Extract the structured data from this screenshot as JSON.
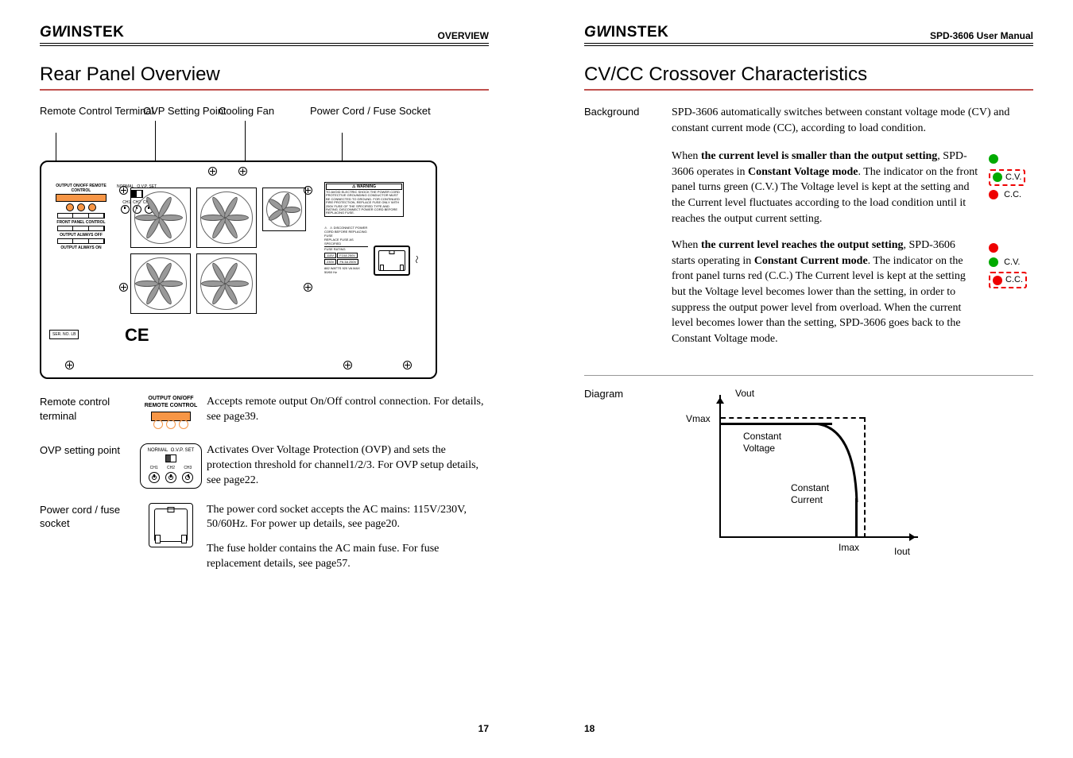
{
  "left": {
    "brand": "GWINSTEK",
    "header_right": "OVERVIEW",
    "title": "Rear Panel Overview",
    "callouts": {
      "remote": "Remote Control Terminal",
      "ovp": "OVP Setting Point",
      "fan": "Cooling Fan",
      "power": "Power Cord / Fuse Socket"
    },
    "panel": {
      "switch_title": "OUTPUT ON/OFF REMOTE CONTROL",
      "switch_lbl1": "FRONT PANEL CONTROL",
      "switch_lbl2": "OUTPUT ALWAYS OFF",
      "switch_lbl3": "OUTPUT ALWAYS ON",
      "ovp_normal": "NORMAL",
      "ovp_set": "O.V.P. SET",
      "ch1": "CH1",
      "ch2": "CH2",
      "ch3": "CH3",
      "serial": "SER. NO.  LB",
      "ce": "CE",
      "warning_title": "⚠ WARNING",
      "warning_body": "TO AVOID ELECTRIC SHOCK THE POWER CORD PROTECTIVE GROUNDING CONDUCTOR MUST BE CONNECTED TO GROUND. FOR CONTINUED FIRE PROTECTION, REPLACE FUSE ONLY WITH 250V FUSE OF THE SPECIFIED TYPE AND RATING. DISCONNECT POWER CORD BEFORE REPLACING FUSE.",
      "disconnect": "DISCONNECT POWER CORD BEFORE REPLACING FUSE",
      "replace_fuse": "REPLACE FUSE AS SPECIFIED",
      "fuse_rating": "FUSE RATING",
      "r115": "115V",
      "r230": "230V",
      "f10a": "F10A 250V",
      "f63a": "F6.3A 250V",
      "watts": "882  WATTS  920  VA  MAX  50/60 Hz",
      "tilde": "〜"
    },
    "desc": {
      "remote_label": "Remote control terminal",
      "remote_icon_title": "OUTPUT ON/OFF\nREMOTE CONTROL",
      "remote_text": "Accepts remote output On/Off control connection. For details, see page39.",
      "ovp_label": "OVP setting point",
      "ovp_icon_normal": "NORMAL",
      "ovp_icon_set": "O.V.P. SET",
      "ovp_text": "Activates Over Voltage Protection (OVP) and sets the protection threshold for channel1/2/3. For OVP setup details, see page22.",
      "power_label": "Power cord / fuse socket",
      "power_text1": "The power cord socket accepts the AC mains: 115V/230V, 50/60Hz. For power up details, see page20.",
      "power_text2": "The fuse holder contains the AC main fuse. For fuse replacement details, see page57."
    },
    "page_num": "17"
  },
  "right": {
    "brand": "GWINSTEK",
    "header_right": "SPD-3606 User Manual",
    "title": "CV/CC Crossover Characteristics",
    "bg_label": "Background",
    "bg_text": "SPD-3606 automatically switches between constant voltage mode (CV) and constant current mode (CC), according to load condition.",
    "cv_para": "When the current level is smaller than the output setting, SPD-3606 operates in Constant Voltage mode. The indicator on the front panel turns green (C.V.) The Voltage level is kept at the setting and the Current level fluctuates according to the load condition until it reaches the output current setting.",
    "cc_para": "When the current level reaches the output setting, SPD-3606 starts operating in Constant Current mode. The indicator on the front panel turns red (C.C.) The Current level is kept at the setting but the Voltage level becomes lower than the setting, in order to suppress the output power level from overload. When the current level becomes lower than the setting, SPD-3606 goes back to the Constant Voltage mode.",
    "ind_cv": "C.V.",
    "ind_cc": "C.C.",
    "diagram_label": "Diagram",
    "diag": {
      "vout": "Vout",
      "vmax": "Vmax",
      "cv": "Constant Voltage",
      "cc": "Constant Current",
      "imax": "Imax",
      "iout": "Iout"
    },
    "page_num": "18"
  }
}
